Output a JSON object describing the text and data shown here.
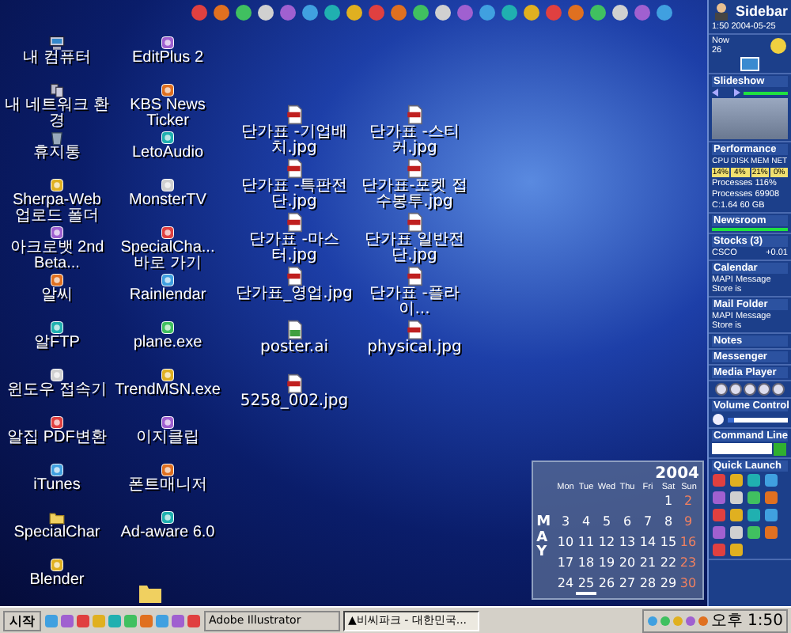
{
  "desktop": {
    "icons": [
      {
        "label": "내 컴퓨터",
        "kind": "computer"
      },
      {
        "label": "내 네트워크 환경",
        "kind": "network"
      },
      {
        "label": "휴지통",
        "kind": "trash"
      },
      {
        "label": "Sherpa-Web 업로드 폴더",
        "kind": "app"
      },
      {
        "label": "아크로뱃 2nd Beta...",
        "kind": "app"
      },
      {
        "label": "알씨",
        "kind": "app"
      },
      {
        "label": "알FTP",
        "kind": "app"
      },
      {
        "label": "윈도우 접속기",
        "kind": "app"
      },
      {
        "label": "알집 PDF변환",
        "kind": "app"
      },
      {
        "label": "iTunes",
        "kind": "app"
      },
      {
        "label": "SpecialChar",
        "kind": "folder"
      },
      {
        "label": "Blender",
        "kind": "app"
      },
      {
        "label": "EditPlus 2",
        "kind": "app"
      },
      {
        "label": "KBS News Ticker",
        "kind": "app"
      },
      {
        "label": "LetoAudio",
        "kind": "app"
      },
      {
        "label": "MonsterTV",
        "kind": "app"
      },
      {
        "label": "SpecialCha... 바로 가기",
        "kind": "app"
      },
      {
        "label": "Rainlendar",
        "kind": "app"
      },
      {
        "label": "plane.exe",
        "kind": "app"
      },
      {
        "label": "TrendMSN.exe",
        "kind": "app"
      },
      {
        "label": "이지클립",
        "kind": "app"
      },
      {
        "label": "폰트매니저",
        "kind": "app"
      },
      {
        "label": "Ad-aware 6.0",
        "kind": "app"
      }
    ],
    "files": [
      {
        "label": "단가표 -기업배치.jpg",
        "kind": "image"
      },
      {
        "label": "단가표 -특판전단.jpg",
        "kind": "image"
      },
      {
        "label": "단가표 -마스터.jpg",
        "kind": "image"
      },
      {
        "label": "단가표_영업.jpg",
        "kind": "image"
      },
      {
        "label": "poster.ai",
        "kind": "vector"
      },
      {
        "label": "5258_002.jpg",
        "kind": "image"
      },
      {
        "label": "단가표 -스티커.jpg",
        "kind": "image"
      },
      {
        "label": "단가표-포켓 접수봉투.jpg",
        "kind": "image"
      },
      {
        "label": "단가표 일반전단.jpg",
        "kind": "image"
      },
      {
        "label": "단가표 -플라이...",
        "kind": "image"
      },
      {
        "label": "physical.jpg",
        "kind": "image"
      }
    ]
  },
  "calendar": {
    "year": "2004",
    "month": "MAY",
    "weekdays": [
      "Mon",
      "Tue",
      "Wed",
      "Thu",
      "Fri",
      "Sat",
      "Sun"
    ],
    "weeks": [
      [
        {
          "day": "1",
          "today": false
        },
        {
          "day": "2",
          "today": false
        }
      ],
      [
        {
          "day": "3",
          "today": false
        },
        {
          "day": "4",
          "today": false
        },
        {
          "day": "5",
          "today": false
        },
        {
          "day": "6",
          "today": false
        },
        {
          "day": "7",
          "today": false
        },
        {
          "day": "8",
          "today": false
        },
        {
          "day": "9",
          "today": false
        }
      ],
      [
        {
          "day": "10",
          "today": false
        },
        {
          "day": "11",
          "today": false
        },
        {
          "day": "12",
          "today": false
        },
        {
          "day": "13",
          "today": false
        },
        {
          "day": "14",
          "today": false
        },
        {
          "day": "15",
          "today": false
        },
        {
          "day": "16",
          "today": false
        }
      ],
      [
        {
          "day": "17",
          "today": false
        },
        {
          "day": "18",
          "today": false
        },
        {
          "day": "19",
          "today": false
        },
        {
          "day": "20",
          "today": false
        },
        {
          "day": "21",
          "today": false
        },
        {
          "day": "22",
          "today": false
        },
        {
          "day": "23",
          "today": false
        }
      ],
      [
        {
          "day": "24",
          "today": false
        },
        {
          "day": "25",
          "today": true
        },
        {
          "day": "26",
          "today": false
        },
        {
          "day": "27",
          "today": false
        },
        {
          "day": "28",
          "today": false
        },
        {
          "day": "29",
          "today": false
        },
        {
          "day": "30",
          "today": false
        }
      ]
    ]
  },
  "sidebar": {
    "panels": [
      {
        "kind": "header",
        "title": "Sidebar",
        "clock": "1:50 2004-05-25"
      },
      {
        "kind": "weather",
        "label": "Now",
        "temp": "26"
      },
      {
        "kind": "slideshow",
        "title": "Slideshow"
      },
      {
        "kind": "performance",
        "title": "Performance",
        "meters": [
          {
            "name": "CPU",
            "reading": "14%"
          },
          {
            "name": "DISK",
            "reading": "4%"
          },
          {
            "name": "MEM",
            "reading": "21%"
          },
          {
            "name": "NET",
            "reading": "0%"
          }
        ],
        "lines": [
          "Processes 116%",
          "Processes 69908",
          "C:1.64 60 GB"
        ]
      },
      {
        "kind": "newsroom",
        "title": "Newsroom"
      },
      {
        "kind": "stocks",
        "title": "Stocks (3)",
        "rows": [
          {
            "symbol": "CSCO",
            "change": "+0.01"
          }
        ]
      },
      {
        "kind": "plugin",
        "title": "Calendar",
        "note": "MAPI Message Store is"
      },
      {
        "kind": "plugin",
        "title": "Mail Folder",
        "note": "MAPI Message Store is"
      },
      {
        "kind": "plugin",
        "title": "Notes"
      },
      {
        "kind": "plugin",
        "title": "Messenger"
      },
      {
        "kind": "plugin",
        "title": "Media Player"
      },
      {
        "kind": "media"
      },
      {
        "kind": "volume",
        "title": "Volume Control",
        "level": 0.1
      },
      {
        "kind": "command",
        "title": "Command Line"
      },
      {
        "kind": "quicklaunch",
        "title": "Quick Launch"
      }
    ]
  },
  "taskbar": {
    "start": "시작",
    "tasks": [
      {
        "label": "Adobe Illustrator",
        "selected": false
      },
      {
        "label": "▲비씨파크 - 대한민국...",
        "selected": true
      }
    ],
    "clock": "오후 1:50"
  }
}
